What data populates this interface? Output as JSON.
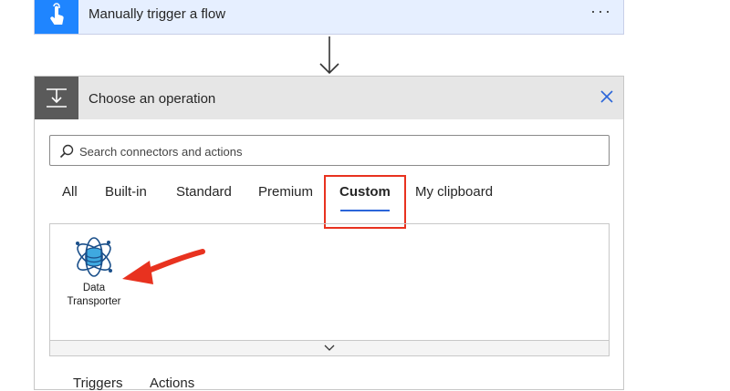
{
  "trigger": {
    "title": "Manually trigger a flow",
    "more_label": "···",
    "icon": "touch-hand-icon",
    "accent": "#1f85ff"
  },
  "operation": {
    "title": "Choose an operation",
    "icon": "operation-insert-icon",
    "close_icon": "close-icon",
    "search": {
      "placeholder": "Search connectors and actions",
      "value": ""
    },
    "tabs": [
      {
        "label": "All",
        "active": false
      },
      {
        "label": "Built-in",
        "active": false
      },
      {
        "label": "Standard",
        "active": false
      },
      {
        "label": "Premium",
        "active": false
      },
      {
        "label": "Custom",
        "active": true
      },
      {
        "label": "My clipboard",
        "active": false
      }
    ],
    "connectors": [
      {
        "label": "Data Transporter",
        "icon": "database-atom-icon"
      }
    ],
    "expand_icon": "chevron-down-icon",
    "bottom_tabs": [
      "Triggers",
      "Actions"
    ]
  },
  "annotations": {
    "highlight_color": "#e8321f",
    "arrow_color": "#e8321f"
  },
  "colors": {
    "tab_underline": "#2b65d9",
    "header_gray": "#e6e6e6",
    "icon_box_gray": "#5a5a5a"
  }
}
